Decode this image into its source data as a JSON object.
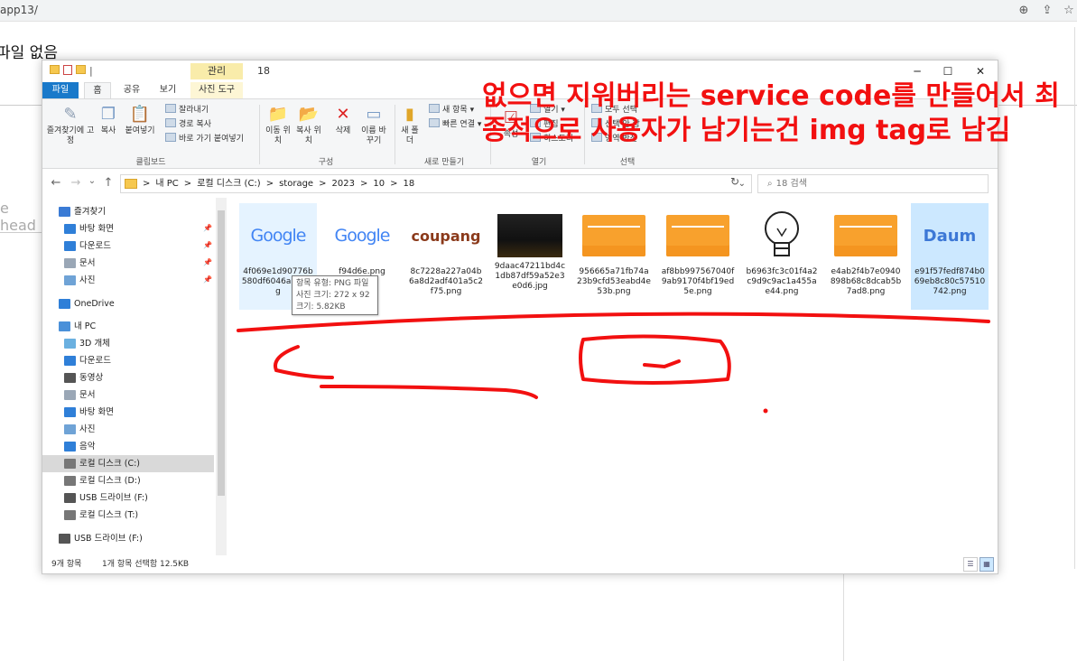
{
  "browser": {
    "url": "app13/",
    "icons": [
      "zoom-icon",
      "share-icon",
      "star-icon"
    ]
  },
  "page": {
    "title": "파일 없음",
    "input_placeholder": "e head"
  },
  "explorer": {
    "qat_label": "|",
    "manage_tab": "관리",
    "title": "18",
    "controls": {
      "minimize": "─",
      "maximize": "☐",
      "close": "✕"
    },
    "tabs": {
      "file": "파일",
      "home": "홈",
      "share": "공유",
      "view": "보기",
      "picture_tools": "사진 도구"
    },
    "ribbon": {
      "pin": "즐겨찾기에 고정",
      "copy": "복사",
      "paste": "붙여넣기",
      "cut": "잘라내기",
      "copy_path": "경로 복사",
      "paste_shortcut": "바로 가기 붙여넣기",
      "group_clipboard": "클립보드",
      "move_to": "이동 위치",
      "copy_to": "복사 위치",
      "delete": "삭제",
      "rename": "이름 바꾸기",
      "group_organize": "구성",
      "new_folder": "새 폴더",
      "new_item": "새 항목",
      "easy_access": "빠른 연결",
      "group_new": "새로 만들기",
      "properties": "속성",
      "open": "열기",
      "edit": "편집",
      "history": "히스토리",
      "group_open": "열기",
      "select_all": "모두 선택",
      "select_none": "선택 안 함",
      "invert": "영역 반전",
      "group_select": "선택"
    },
    "nav_buttons": {
      "back": "←",
      "forward": "→",
      "recent": "⌄",
      "up": "↑"
    },
    "path": [
      "내 PC",
      "로컬 디스크 (C:)",
      "storage",
      "2023",
      "10",
      "18"
    ],
    "path_sep": ">",
    "dropdown": "⌄",
    "refresh": "↻",
    "search_placeholder": "18 검색",
    "sidebar": [
      {
        "label": "즐겨찾기",
        "icon": "star-icon"
      },
      {
        "label": "바탕 화면",
        "icon": "desktop-icon",
        "pinned": true
      },
      {
        "label": "다운로드",
        "icon": "download-icon",
        "pinned": true
      },
      {
        "label": "문서",
        "icon": "document-icon",
        "pinned": true
      },
      {
        "label": "사진",
        "icon": "pictures-icon",
        "pinned": true
      },
      {
        "label": "OneDrive",
        "icon": "cloud-icon"
      },
      {
        "label": "내 PC",
        "icon": "pc-icon"
      },
      {
        "label": "3D 개체",
        "icon": "cube-icon"
      },
      {
        "label": "다운로드",
        "icon": "download-icon"
      },
      {
        "label": "동영상",
        "icon": "video-icon"
      },
      {
        "label": "문서",
        "icon": "document-icon"
      },
      {
        "label": "바탕 화면",
        "icon": "desktop-icon"
      },
      {
        "label": "사진",
        "icon": "pictures-icon"
      },
      {
        "label": "음악",
        "icon": "music-icon"
      },
      {
        "label": "로컬 디스크 (C:)",
        "icon": "drive-icon",
        "selected": true
      },
      {
        "label": "로컬 디스크 (D:)",
        "icon": "drive-icon"
      },
      {
        "label": "USB 드라이브 (F:)",
        "icon": "usb-icon"
      },
      {
        "label": "로컬 디스크 (T:)",
        "icon": "drive-icon"
      },
      {
        "label": "USB 드라이브 (F:)",
        "icon": "usb-icon"
      }
    ],
    "files": [
      {
        "name": "4f069e1d90776b580df6046a89.png",
        "thumb": "google",
        "thumb_text": "Google",
        "state": "hover"
      },
      {
        "name": "f94d6e.png",
        "thumb": "google",
        "thumb_text": "Google"
      },
      {
        "name": "8c7228a227a04b6a8d2adf401a5c2f75.png",
        "thumb": "coupang",
        "thumb_text": "coupang"
      },
      {
        "name": "9daac47211bd4c1db87df59a52e3e0d6.jpg",
        "thumb": "photo",
        "thumb_text": ""
      },
      {
        "name": "956665a71fb74a23b9cfd53eabd4e53b.png",
        "thumb": "zip",
        "thumb_text": ""
      },
      {
        "name": "af8bb997567040f9ab9170f4bf19ed5e.png",
        "thumb": "zip",
        "thumb_text": ""
      },
      {
        "name": "b6963fc3c01f4a2c9d9c9ac1a455ae44.png",
        "thumb": "bulb",
        "thumb_text": ""
      },
      {
        "name": "e4ab2f4b7e0940898b68c8dcab5b7ad8.png",
        "thumb": "zip",
        "thumb_text": ""
      },
      {
        "name": "e91f57fedf874b069eb8c80c57510742.png",
        "thumb": "daum",
        "thumb_text": "Daum",
        "state": "selected"
      }
    ],
    "tooltip": {
      "type": "항목 유형: PNG 파일",
      "dimensions": "사진 크기: 272 x 92",
      "size": "크기: 5.82KB"
    },
    "status": {
      "count": "9개 항목",
      "selection": "1개 항목 선택함 12.5KB"
    },
    "view_buttons": {
      "details": "☰",
      "icons": "▦"
    }
  },
  "annotation": {
    "text": "없으면 지워버리는 service code를 만들어서 최종적으로 사용자가 남기는건 img tag로 남김",
    "color": "#f21010"
  }
}
